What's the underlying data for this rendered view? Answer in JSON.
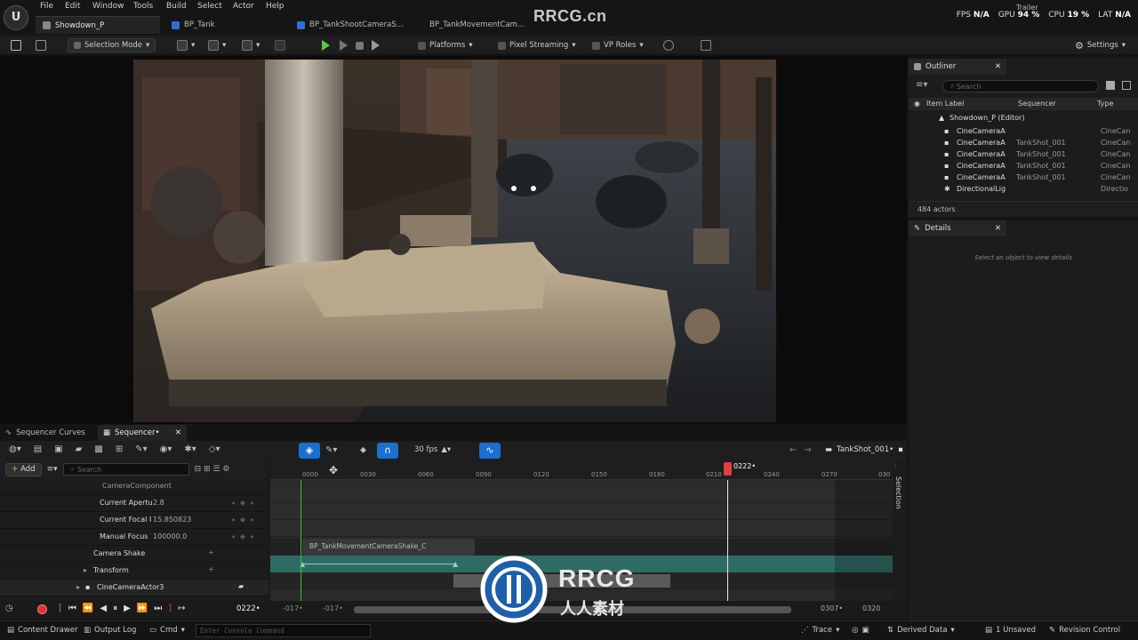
{
  "menu": {
    "items": [
      "File",
      "Edit",
      "Window",
      "Tools",
      "Build",
      "Select",
      "Actor",
      "Help"
    ]
  },
  "doc_tabs": [
    {
      "label": "Showdown_P",
      "active": true
    },
    {
      "label": "BP_Tank",
      "active": false
    },
    {
      "label": "BP_TankShootCameraS...",
      "active": false
    },
    {
      "label": "BP_TankMovementCam...",
      "active": false
    }
  ],
  "watermark_top": "RRCG.cn",
  "trailer_label": "Trailer",
  "stats": {
    "fps_label": "FPS",
    "fps_value": "N/A",
    "gpu_label": "GPU",
    "gpu_value": "94 %",
    "cpu_label": "CPU",
    "cpu_value": "19 %",
    "lat_label": "LAT",
    "lat_value": "N/A"
  },
  "toolbar": {
    "selection_mode": "Selection Mode",
    "platforms": "Platforms",
    "pixel_streaming": "Pixel Streaming",
    "vp_roles": "VP Roles",
    "settings": "Settings"
  },
  "outliner": {
    "tab_label": "Outliner",
    "search_placeholder": "Search",
    "col_item_label": "Item Label",
    "col_sequencer": "Sequencer",
    "col_type": "Type",
    "root": "Showdown_P (Editor)",
    "rows": [
      {
        "label": "CineCameraA",
        "sequencer": "",
        "type": "CineCan"
      },
      {
        "label": "CineCameraA",
        "sequencer": "TankShot_001",
        "type": "CineCan"
      },
      {
        "label": "CineCameraA",
        "sequencer": "TankShot_001",
        "type": "CineCan"
      },
      {
        "label": "CineCameraA",
        "sequencer": "TankShot_001",
        "type": "CineCan"
      },
      {
        "label": "CineCameraA",
        "sequencer": "TankShot_001",
        "type": "CineCan"
      },
      {
        "label": "DirectionalLig",
        "sequencer": "",
        "type": "Directio"
      }
    ],
    "actor_count": "484 actors"
  },
  "details": {
    "tab_label": "Details",
    "empty_message": "Select an object to view details"
  },
  "sequencer": {
    "tabs": [
      "Sequencer Curves",
      "Sequencer"
    ],
    "active_tab": "Sequencer•",
    "add_label": "Add",
    "search_placeholder": "Search",
    "fps": "30 fps",
    "sequence_name": "TankShot_001•",
    "current_frame": "0222•",
    "selection_label": "Selection",
    "ruler_ticks": [
      "0000",
      "0030",
      "0060",
      "0090",
      "0120",
      "0150",
      "0180",
      "0210",
      "0240",
      "0270",
      "030"
    ],
    "tracks": [
      {
        "label": "CameraComponent",
        "value": "",
        "indent": 1
      },
      {
        "label": "Current Apertu",
        "value": "2.8",
        "indent": 2
      },
      {
        "label": "Current Focal I",
        "value": "15.850823",
        "indent": 2
      },
      {
        "label": "Manual Focus",
        "value": "100000.0",
        "indent": 2
      },
      {
        "label": "Camera Shake",
        "value": "",
        "indent": 1
      },
      {
        "label": "Transform",
        "value": "",
        "indent": 1
      },
      {
        "label": "CineCameraActor3",
        "value": "",
        "indent": 0
      }
    ],
    "shake_section": "BP_TankMovementCameraShake_C",
    "transport": {
      "frame": "0222•",
      "range_start_a": "-017•",
      "range_start_b": "-017•",
      "range_end_a": "0307•",
      "range_end_b": "0320"
    }
  },
  "statusbar": {
    "content_drawer": "Content Drawer",
    "output_log": "Output Log",
    "cmd": "Cmd",
    "console_placeholder": "Enter Console Command",
    "trace": "Trace",
    "derived_data": "Derived Data",
    "unsaved": "1 Unsaved",
    "revision_control": "Revision Control"
  },
  "center_logo": {
    "title": "RRCG",
    "subtitle": "人人素材"
  },
  "colors": {
    "accent_blue": "#1a6fd1",
    "play_green": "#5bc84a",
    "playhead_red": "#e04040",
    "transform_lane": "#2f6b63"
  }
}
